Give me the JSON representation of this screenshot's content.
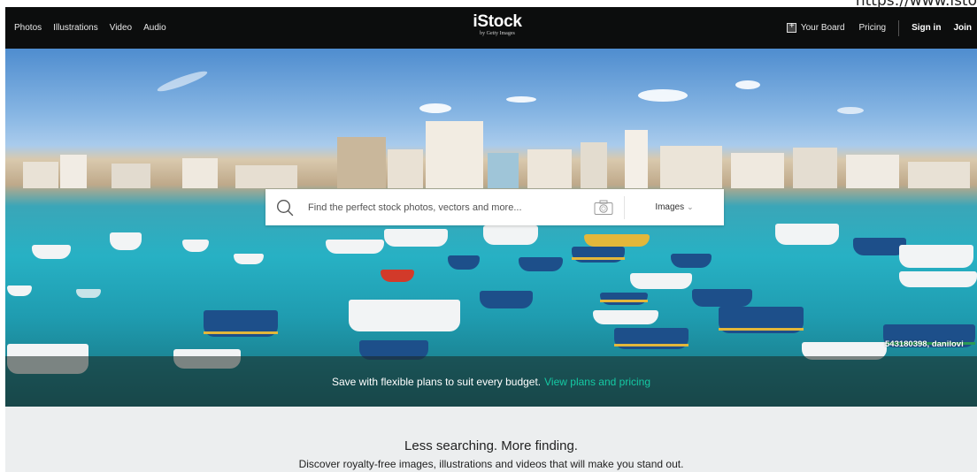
{
  "url_fragment": "https://www.isto",
  "header": {
    "nav_left": [
      "Photos",
      "Illustrations",
      "Video",
      "Audio"
    ],
    "logo_main": "iStock",
    "logo_sub": "by Getty Images",
    "your_board": "Your Board",
    "pricing": "Pricing",
    "sign_in": "Sign in",
    "join": "Join"
  },
  "search": {
    "placeholder": "Find the perfect stock photos, vectors and more...",
    "type_selected": "Images"
  },
  "hero": {
    "credit": "543180398, danilovi"
  },
  "promo": {
    "text": "Save with flexible plans to suit every budget.",
    "link": "View plans and pricing"
  },
  "body": {
    "tagline": "Less searching. More finding.",
    "subline": "Discover royalty-free images, illustrations and videos that will make you stand out."
  },
  "colors": {
    "topbar": "#0c0d0d",
    "link_accent": "#15c9a3",
    "section_bg": "#eceeef"
  },
  "icons": [
    "board-icon",
    "search-icon",
    "camera-icon",
    "chevron-down-icon"
  ]
}
